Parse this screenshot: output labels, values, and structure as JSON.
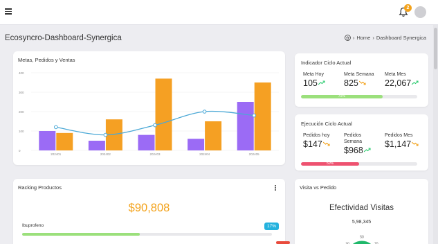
{
  "app": {
    "title": "Ecosyncro-Dashboard-Synergica",
    "notification_count": "2",
    "breadcrumb": {
      "home": "Home",
      "current": "Dashboard Synergica"
    }
  },
  "chart_card": {
    "title": "Metas, Pedidos y Ventas",
    "chart_data": {
      "type": "bar",
      "categories": [
        "202401",
        "202402",
        "202403",
        "202404",
        "202405"
      ],
      "ylim": [
        0,
        400
      ],
      "yticks": [
        "0",
        "100",
        "200",
        "300",
        "400"
      ],
      "grid": true,
      "series": [
        {
          "type": "bar",
          "color": "#9b6bf5",
          "values": [
            100,
            50,
            80,
            60,
            250
          ]
        },
        {
          "type": "bar",
          "color": "#f5a023",
          "values": [
            90,
            160,
            370,
            150,
            350
          ]
        },
        {
          "type": "line",
          "color": "#4aa8d6",
          "values": [
            120,
            80,
            130,
            200,
            180
          ]
        }
      ]
    }
  },
  "indicador": {
    "title": "Indicador Ciclo Actual",
    "items": [
      {
        "label": "Meta Hoy",
        "value": "105",
        "trend": "up"
      },
      {
        "label": "Meta Semana",
        "value": "825",
        "trend": "down"
      },
      {
        "label": "Meta Mes",
        "value": "22,067",
        "trend": "up"
      }
    ],
    "progress": {
      "value": 0.7,
      "label": "70%",
      "color": "#9be07c"
    }
  },
  "ejecucion": {
    "title": "Ejecución Ciclo Actual",
    "items": [
      {
        "label": "Pedidos hoy",
        "value": "$147",
        "trend": "down"
      },
      {
        "label": "Pedidos Semana",
        "value": "$968",
        "trend": "up"
      },
      {
        "label": "Pedidos Mes",
        "value": "$1,147",
        "trend": "down"
      }
    ],
    "progress": {
      "value": 0.5,
      "label": "50%",
      "color": "#ee5270"
    }
  },
  "racking": {
    "title": "Racking Productos",
    "total": "$90,808",
    "items": [
      {
        "name": "Ibuprofeno",
        "percent": 0.47,
        "badge": "17%",
        "bar_color": "#9be07c",
        "badge_color": "#25b2de"
      }
    ],
    "next_badge_color": "#e94b3c"
  },
  "visita": {
    "title": "Visita vs Pedido",
    "subtitle": "Efectividad Visitas",
    "value": "5,98,345",
    "gauge": {
      "ticks": [
        "30",
        "50",
        "70"
      ],
      "color": "#1fb86a"
    }
  },
  "colors": {
    "up": "#2ecc71",
    "down": "#f3a21a"
  }
}
